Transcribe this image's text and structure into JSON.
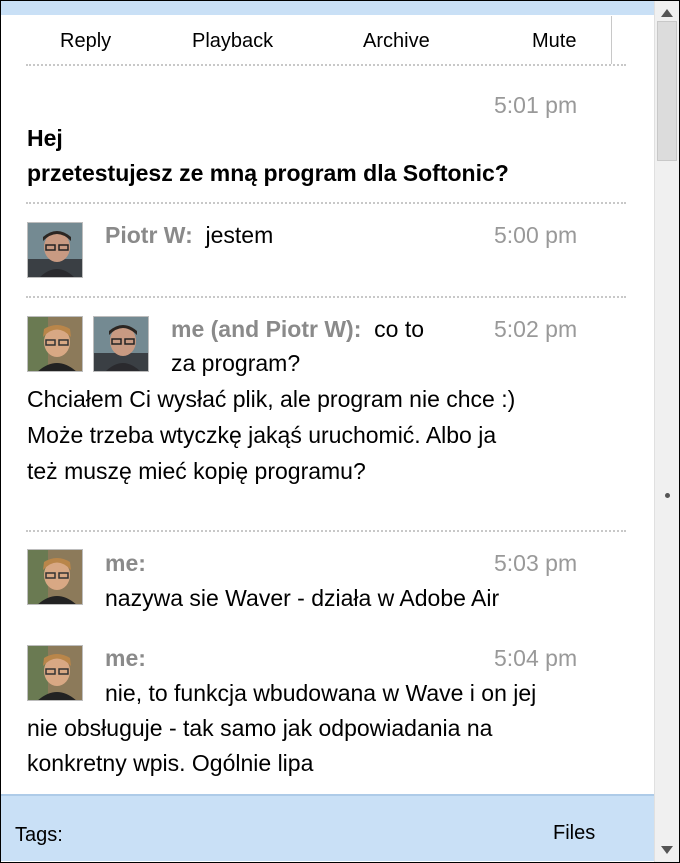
{
  "toolbar": {
    "reply": "Reply",
    "playback": "Playback",
    "archive": "Archive",
    "mute": "Mute"
  },
  "root": {
    "time": "5:01 pm",
    "line1": "Hej",
    "line2": "przetestujesz ze mną program dla Softonic?"
  },
  "messages": [
    {
      "author": "Piotr W:",
      "text": "jestem",
      "time": "5:00 pm"
    },
    {
      "author": "me (and Piotr W):",
      "text_inline": "co to",
      "time": "5:02 pm",
      "lines": [
        "za program?",
        "Chciałem Ci wysłać plik, ale program nie chce :)",
        "Może trzeba wtyczkę jakąś uruchomić. Albo ja",
        "też muszę mieć kopię programu?"
      ]
    },
    {
      "author": "me:",
      "time": "5:03 pm",
      "lines": [
        "nazywa sie Waver - działa w Adobe Air"
      ]
    },
    {
      "author": "me:",
      "time": "5:04 pm",
      "lines": [
        "nie, to funkcja wbudowana w Wave i on jej",
        "nie obsługuje - tak samo jak odpowiadania na",
        "konkretny wpis. Ogólnie lipa"
      ]
    }
  ],
  "footer": {
    "tags": "Tags:",
    "files": "Files"
  },
  "colors": {
    "panel": "#c9e0f6",
    "muted": "#999999"
  },
  "icons": [
    "arrow-up-icon",
    "arrow-down-icon"
  ]
}
